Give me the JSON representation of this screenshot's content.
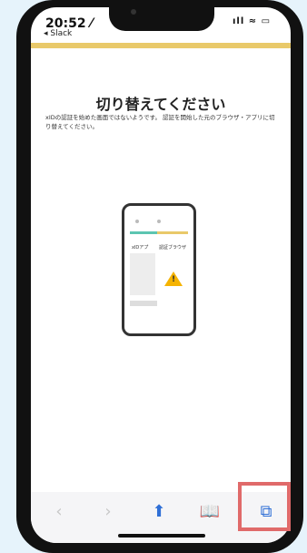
{
  "status": {
    "time": "20:52 ⁄",
    "back_label": "◂ Slack",
    "indicators": "ıll ≈ ▭"
  },
  "page": {
    "title": "切り替えてください",
    "description": "xIDの認証を始めた画面ではないようです。\n認証を開始した元のブラウザ・アプリに切り替えてください。"
  },
  "illustration": {
    "label_left": "xIDアプ",
    "label_right": "認証ブラウザ"
  },
  "toolbar": {
    "back": "‹",
    "forward": "›",
    "share": "⬆",
    "bookmarks": "📖",
    "tabs": "⧉"
  },
  "colors": {
    "accent_yellow": "#e9c96a",
    "accent_teal": "#5cc5b1",
    "highlight": "#e06a6a"
  }
}
